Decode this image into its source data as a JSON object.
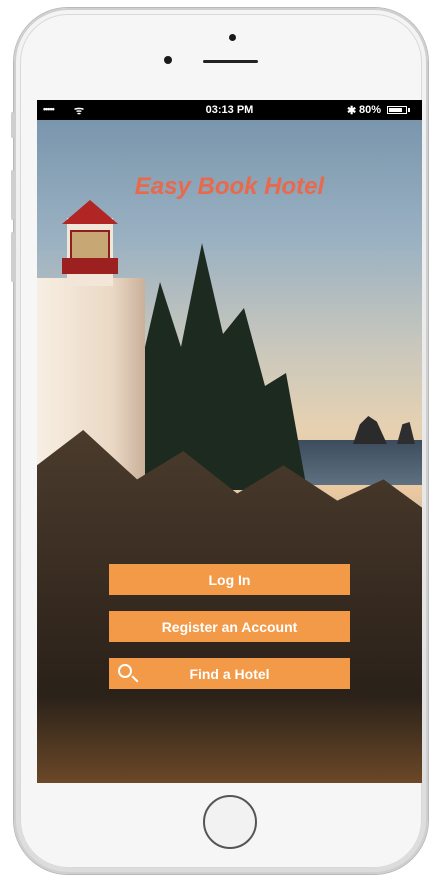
{
  "status_bar": {
    "signal": "•••••",
    "wifi_icon": "wifi-icon",
    "time": "03:13 PM",
    "bluetooth_icon": "bluetooth-icon",
    "battery_percent": "80%",
    "battery_level": 0.8
  },
  "app": {
    "title": "Easy Book Hotel"
  },
  "actions": {
    "login_label": "Log In",
    "register_label": "Register an Account",
    "find_label": "Find a Hotel"
  },
  "colors": {
    "button_bg": "#f29a48",
    "title_color": "#e8694b"
  }
}
